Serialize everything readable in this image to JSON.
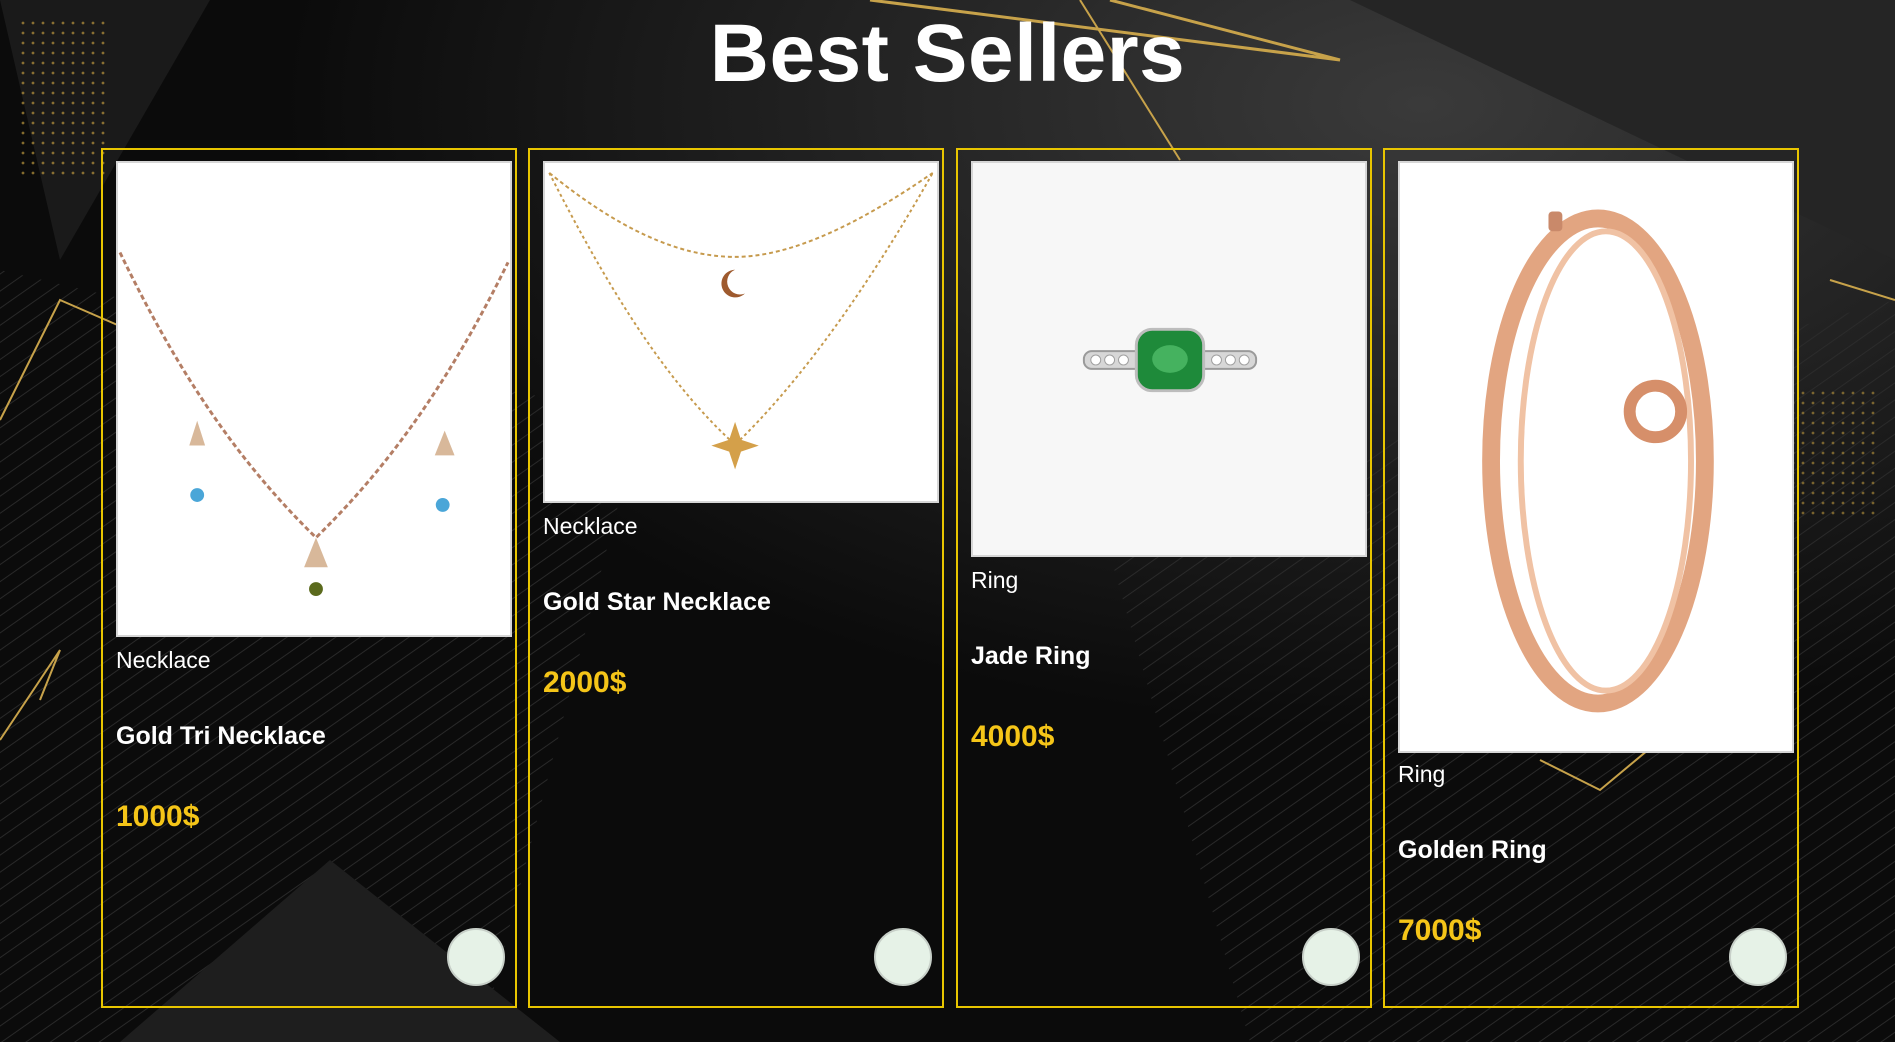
{
  "page": {
    "title": "Best Sellers"
  },
  "theme": {
    "border_color": "#e8c500",
    "price_color": "#f5c518",
    "button_color": "#e6f2e7"
  },
  "products": [
    {
      "category": "Necklace",
      "name": "Gold Tri Necklace",
      "price": "1000$",
      "image_icon": "tri-pendant-necklace-icon"
    },
    {
      "category": "Necklace",
      "name": "Gold Star Necklace",
      "price": "2000$",
      "image_icon": "moon-star-necklace-icon"
    },
    {
      "category": "Ring",
      "name": "Jade Ring",
      "price": "4000$",
      "image_icon": "jade-ring-icon"
    },
    {
      "category": "Ring",
      "name": "Golden Ring",
      "price": "7000$",
      "image_icon": "knot-bangle-icon"
    }
  ]
}
